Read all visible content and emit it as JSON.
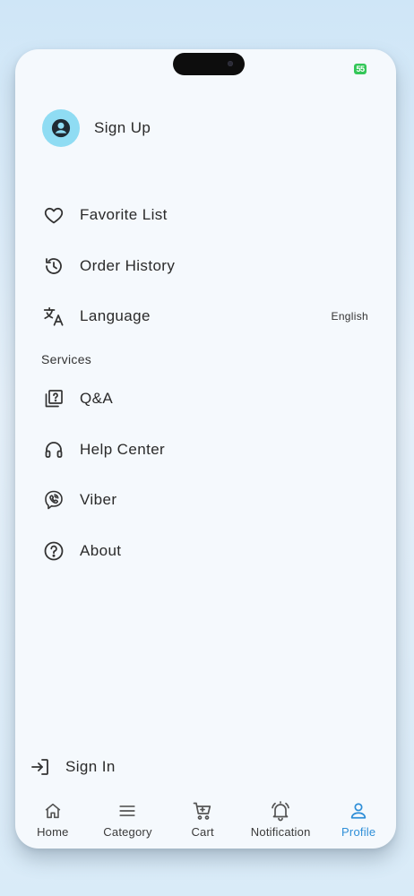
{
  "status_bar": {
    "battery": "55"
  },
  "profile": {
    "signup_label": "Sign Up"
  },
  "menu": [
    {
      "label": "Favorite List",
      "icon": "heart-icon"
    },
    {
      "label": "Order History",
      "icon": "history-icon"
    },
    {
      "label": "Language",
      "icon": "translate-icon",
      "value": "English"
    }
  ],
  "services": {
    "title": "Services",
    "items": [
      {
        "label": "Q&A",
        "icon": "question-box-icon"
      },
      {
        "label": "Help Center",
        "icon": "headset-icon"
      },
      {
        "label": "Viber",
        "icon": "viber-icon"
      },
      {
        "label": "About",
        "icon": "help-circle-icon"
      }
    ]
  },
  "signin": {
    "label": "Sign In",
    "icon": "login-icon"
  },
  "nav": {
    "active": "Profile",
    "active_color": "#2f8fd8",
    "items": [
      {
        "label": "Home",
        "icon": "home-icon"
      },
      {
        "label": "Category",
        "icon": "menu-icon"
      },
      {
        "label": "Cart",
        "icon": "cart-icon"
      },
      {
        "label": "Notification",
        "icon": "bell-icon"
      },
      {
        "label": "Profile",
        "icon": "person-icon"
      }
    ]
  }
}
